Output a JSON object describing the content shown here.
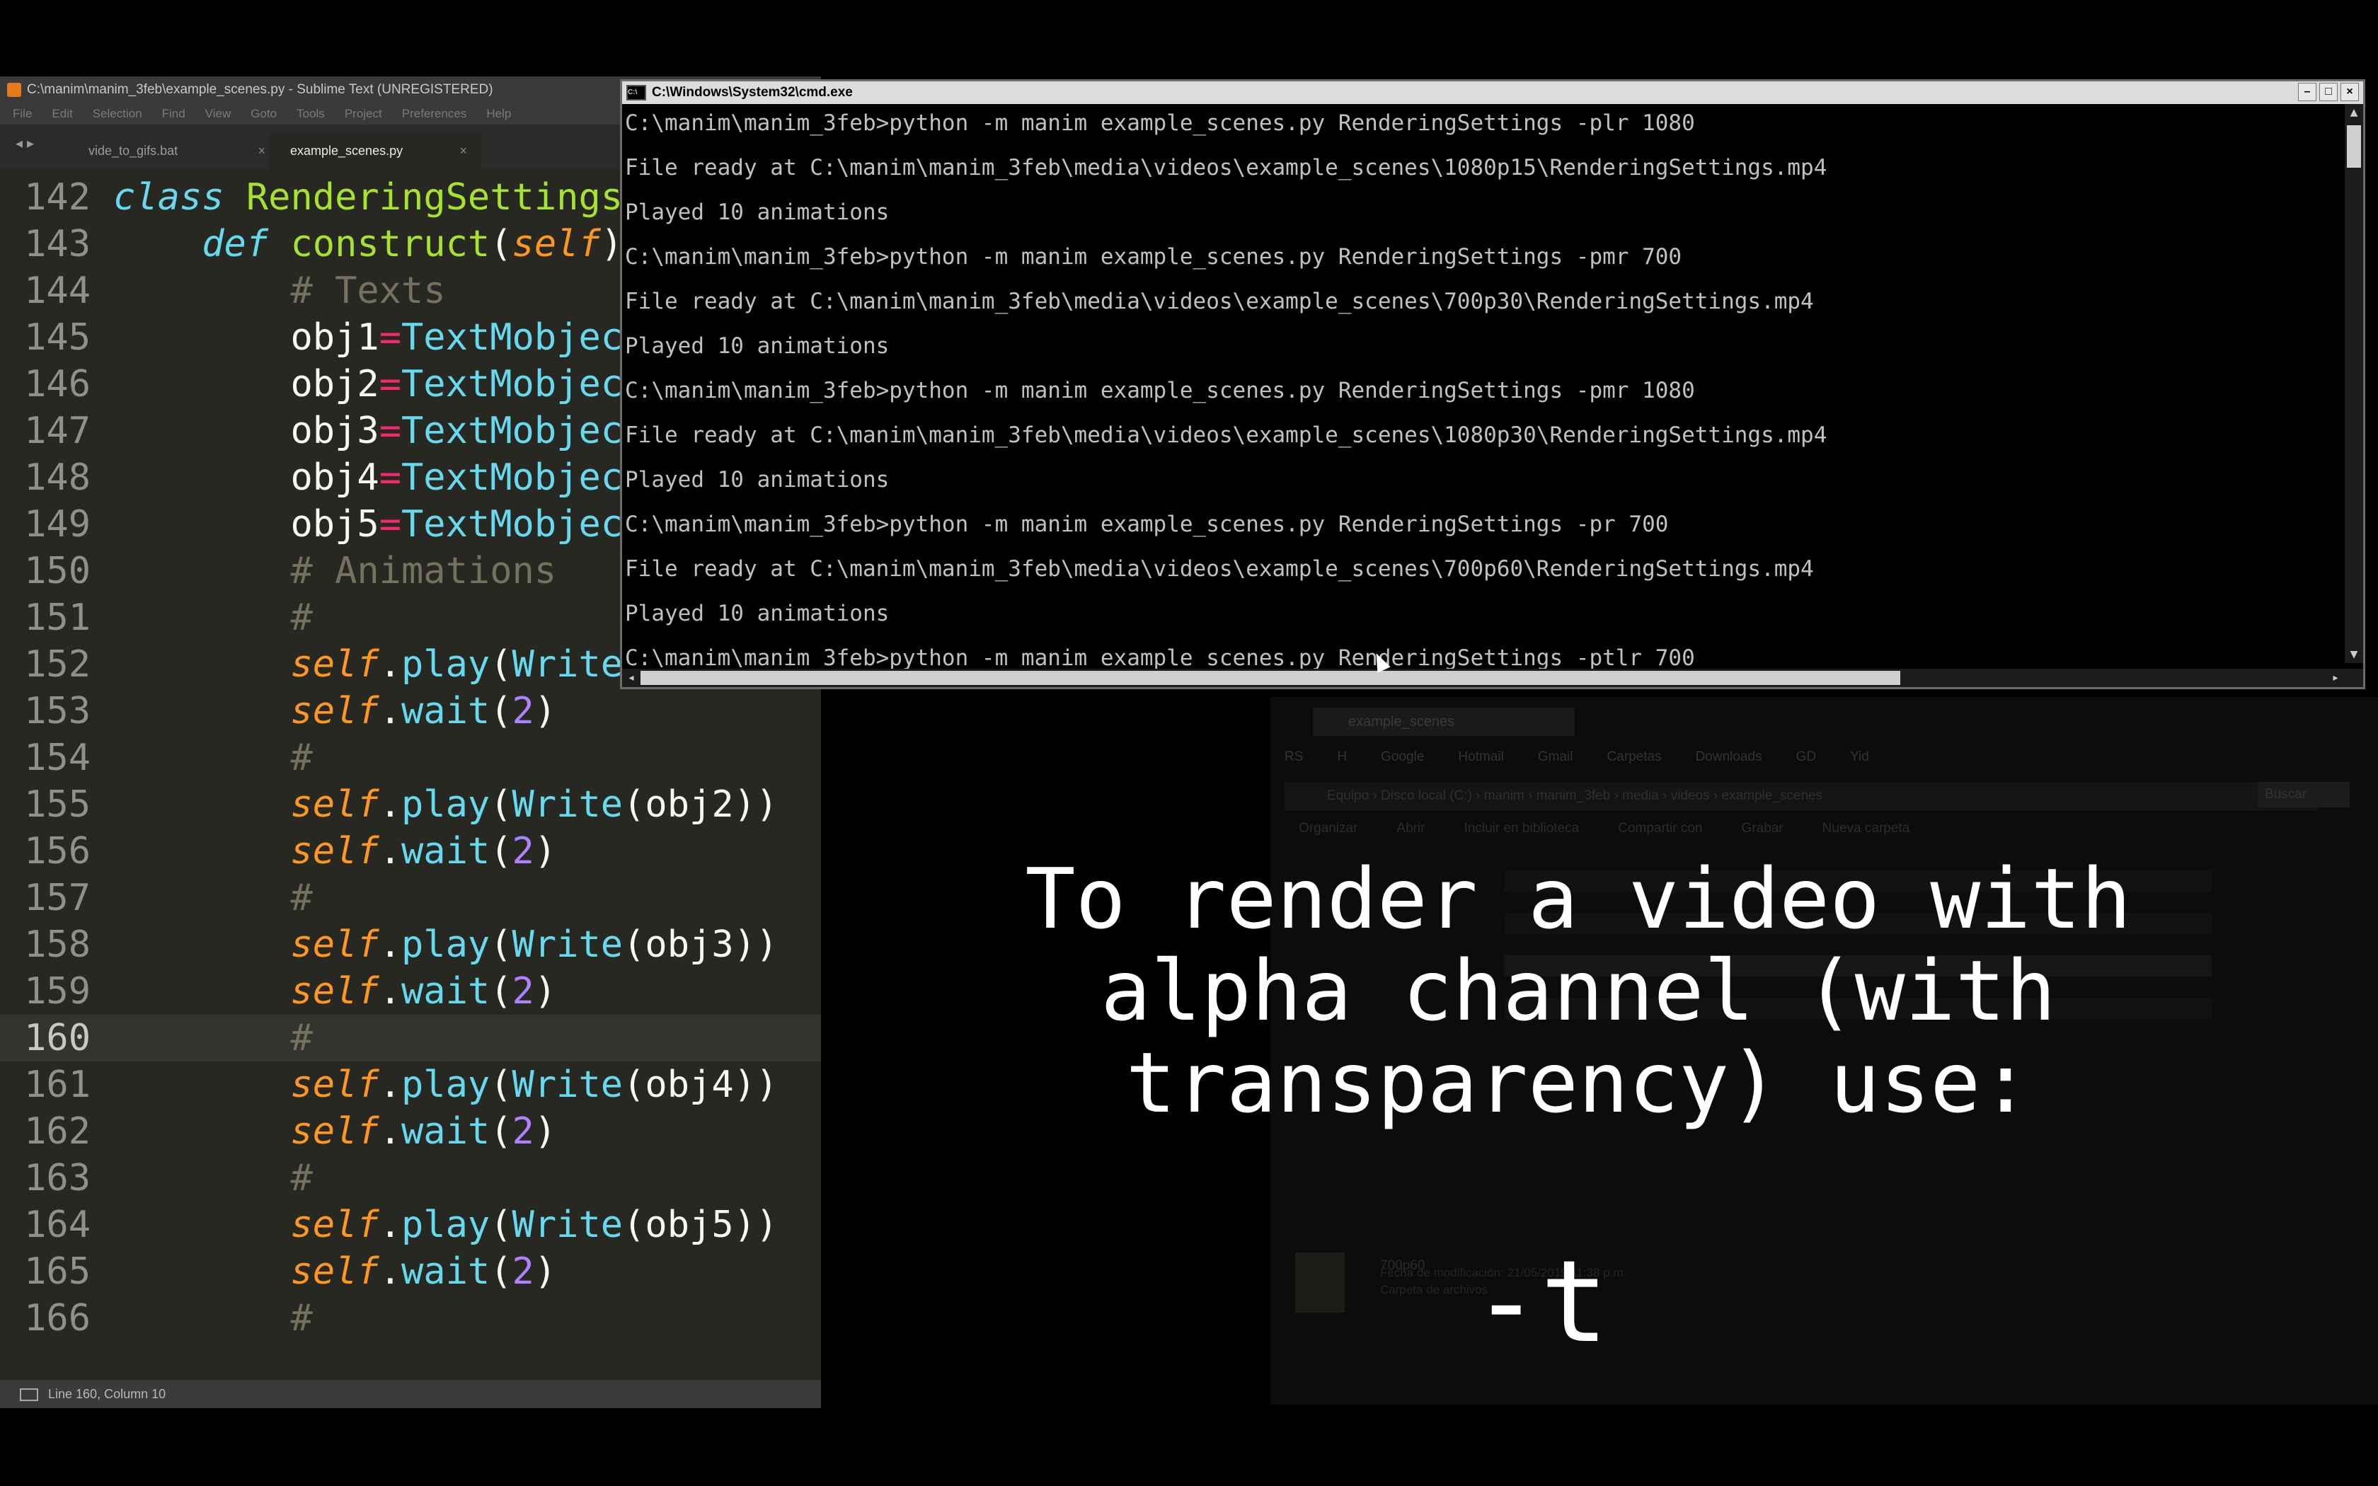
{
  "explorer": {
    "tab_label": "example_scenes",
    "bookmarks": [
      "RS",
      "H",
      "Google",
      "Hotmail",
      "Gmail",
      "Carpetas",
      "Downloads",
      "GD",
      "Yid"
    ],
    "address": "Equipo › Disco local (C:) › manim › manim_3feb › media › videos › example_scenes",
    "search_label": "Buscar",
    "toolbar": [
      "Organizar",
      "Abrir",
      "Incluir en biblioteca",
      "Compartir con",
      "Grabar",
      "Nueva carpeta"
    ],
    "selected_file": {
      "name": "700p60",
      "meta1": "Fecha de modificación: 21/05/2019 11:38 p.m.",
      "meta2": "Carpeta de archivos"
    }
  },
  "sublime": {
    "title": "C:\\manim\\manim_3feb\\example_scenes.py - Sublime Text (UNREGISTERED)",
    "menu": [
      "File",
      "Edit",
      "Selection",
      "Find",
      "View",
      "Goto",
      "Tools",
      "Project",
      "Preferences",
      "Help"
    ],
    "tabs": [
      {
        "label": "vide_to_gifs.bat",
        "active": false
      },
      {
        "label": "example_scenes.py",
        "active": true
      }
    ],
    "status": "Line 160, Column 10",
    "code_lines": [
      {
        "n": "142",
        "tokens": [
          {
            "t": "class",
            "c": "kw"
          },
          {
            "t": " ",
            "c": ""
          },
          {
            "t": "RenderingSettings",
            "c": "cls"
          }
        ]
      },
      {
        "n": "143",
        "tokens": [
          {
            "t": "    ",
            "c": ""
          },
          {
            "t": "def",
            "c": "kw"
          },
          {
            "t": " ",
            "c": ""
          },
          {
            "t": "construct",
            "c": "def"
          },
          {
            "t": "(",
            "c": ""
          },
          {
            "t": "self",
            "c": "self"
          },
          {
            "t": ")",
            "c": ""
          }
        ]
      },
      {
        "n": "144",
        "tokens": [
          {
            "t": "        ",
            "c": ""
          },
          {
            "t": "# Texts",
            "c": "cm"
          }
        ]
      },
      {
        "n": "145",
        "tokens": [
          {
            "t": "        obj1",
            "c": ""
          },
          {
            "t": "=",
            "c": "op"
          },
          {
            "t": "TextMobjec",
            "c": "fn"
          }
        ]
      },
      {
        "n": "146",
        "tokens": [
          {
            "t": "        obj2",
            "c": ""
          },
          {
            "t": "=",
            "c": "op"
          },
          {
            "t": "TextMobjec",
            "c": "fn"
          }
        ]
      },
      {
        "n": "147",
        "tokens": [
          {
            "t": "        obj3",
            "c": ""
          },
          {
            "t": "=",
            "c": "op"
          },
          {
            "t": "TextMobjec",
            "c": "fn"
          }
        ]
      },
      {
        "n": "148",
        "tokens": [
          {
            "t": "        obj4",
            "c": ""
          },
          {
            "t": "=",
            "c": "op"
          },
          {
            "t": "TextMobjec",
            "c": "fn"
          }
        ]
      },
      {
        "n": "149",
        "tokens": [
          {
            "t": "        obj5",
            "c": ""
          },
          {
            "t": "=",
            "c": "op"
          },
          {
            "t": "TextMobjec",
            "c": "fn"
          }
        ]
      },
      {
        "n": "150",
        "tokens": [
          {
            "t": "        ",
            "c": ""
          },
          {
            "t": "# Animations",
            "c": "cm"
          }
        ]
      },
      {
        "n": "151",
        "tokens": [
          {
            "t": "        ",
            "c": ""
          },
          {
            "t": "#",
            "c": "cm"
          }
        ]
      },
      {
        "n": "152",
        "tokens": [
          {
            "t": "        ",
            "c": ""
          },
          {
            "t": "self",
            "c": "self"
          },
          {
            "t": ".",
            "c": ""
          },
          {
            "t": "play",
            "c": "fn"
          },
          {
            "t": "(",
            "c": ""
          },
          {
            "t": "Write",
            "c": "fn"
          }
        ]
      },
      {
        "n": "153",
        "tokens": [
          {
            "t": "        ",
            "c": ""
          },
          {
            "t": "self",
            "c": "self"
          },
          {
            "t": ".",
            "c": ""
          },
          {
            "t": "wait",
            "c": "fn"
          },
          {
            "t": "(",
            "c": ""
          },
          {
            "t": "2",
            "c": "num"
          },
          {
            "t": ")",
            "c": ""
          }
        ]
      },
      {
        "n": "154",
        "tokens": [
          {
            "t": "        ",
            "c": ""
          },
          {
            "t": "#",
            "c": "cm"
          }
        ]
      },
      {
        "n": "155",
        "tokens": [
          {
            "t": "        ",
            "c": ""
          },
          {
            "t": "self",
            "c": "self"
          },
          {
            "t": ".",
            "c": ""
          },
          {
            "t": "play",
            "c": "fn"
          },
          {
            "t": "(",
            "c": ""
          },
          {
            "t": "Write",
            "c": "fn"
          },
          {
            "t": "(obj2))",
            "c": ""
          }
        ]
      },
      {
        "n": "156",
        "tokens": [
          {
            "t": "        ",
            "c": ""
          },
          {
            "t": "self",
            "c": "self"
          },
          {
            "t": ".",
            "c": ""
          },
          {
            "t": "wait",
            "c": "fn"
          },
          {
            "t": "(",
            "c": ""
          },
          {
            "t": "2",
            "c": "num"
          },
          {
            "t": ")",
            "c": ""
          }
        ]
      },
      {
        "n": "157",
        "tokens": [
          {
            "t": "        ",
            "c": ""
          },
          {
            "t": "#",
            "c": "cm"
          }
        ]
      },
      {
        "n": "158",
        "tokens": [
          {
            "t": "        ",
            "c": ""
          },
          {
            "t": "self",
            "c": "self"
          },
          {
            "t": ".",
            "c": ""
          },
          {
            "t": "play",
            "c": "fn"
          },
          {
            "t": "(",
            "c": ""
          },
          {
            "t": "Write",
            "c": "fn"
          },
          {
            "t": "(obj3))",
            "c": ""
          }
        ]
      },
      {
        "n": "159",
        "tokens": [
          {
            "t": "        ",
            "c": ""
          },
          {
            "t": "self",
            "c": "self"
          },
          {
            "t": ".",
            "c": ""
          },
          {
            "t": "wait",
            "c": "fn"
          },
          {
            "t": "(",
            "c": ""
          },
          {
            "t": "2",
            "c": "num"
          },
          {
            "t": ")",
            "c": ""
          }
        ]
      },
      {
        "n": "160",
        "current": true,
        "tokens": [
          {
            "t": "        ",
            "c": ""
          },
          {
            "t": "#",
            "c": "cm"
          }
        ]
      },
      {
        "n": "161",
        "tokens": [
          {
            "t": "        ",
            "c": ""
          },
          {
            "t": "self",
            "c": "self"
          },
          {
            "t": ".",
            "c": ""
          },
          {
            "t": "play",
            "c": "fn"
          },
          {
            "t": "(",
            "c": ""
          },
          {
            "t": "Write",
            "c": "fn"
          },
          {
            "t": "(obj4))",
            "c": ""
          }
        ]
      },
      {
        "n": "162",
        "tokens": [
          {
            "t": "        ",
            "c": ""
          },
          {
            "t": "self",
            "c": "self"
          },
          {
            "t": ".",
            "c": ""
          },
          {
            "t": "wait",
            "c": "fn"
          },
          {
            "t": "(",
            "c": ""
          },
          {
            "t": "2",
            "c": "num"
          },
          {
            "t": ")",
            "c": ""
          }
        ]
      },
      {
        "n": "163",
        "tokens": [
          {
            "t": "        ",
            "c": ""
          },
          {
            "t": "#",
            "c": "cm"
          }
        ]
      },
      {
        "n": "164",
        "tokens": [
          {
            "t": "        ",
            "c": ""
          },
          {
            "t": "self",
            "c": "self"
          },
          {
            "t": ".",
            "c": ""
          },
          {
            "t": "play",
            "c": "fn"
          },
          {
            "t": "(",
            "c": ""
          },
          {
            "t": "Write",
            "c": "fn"
          },
          {
            "t": "(obj5))",
            "c": ""
          }
        ]
      },
      {
        "n": "165",
        "tokens": [
          {
            "t": "        ",
            "c": ""
          },
          {
            "t": "self",
            "c": "self"
          },
          {
            "t": ".",
            "c": ""
          },
          {
            "t": "wait",
            "c": "fn"
          },
          {
            "t": "(",
            "c": ""
          },
          {
            "t": "2",
            "c": "num"
          },
          {
            "t": ")",
            "c": ""
          }
        ]
      },
      {
        "n": "166",
        "tokens": [
          {
            "t": "        ",
            "c": ""
          },
          {
            "t": "#",
            "c": "cm"
          }
        ]
      }
    ]
  },
  "cmd": {
    "title": "C:\\Windows\\System32\\cmd.exe",
    "lines": [
      "C:\\manim\\manim_3feb>python -m manim example_scenes.py RenderingSettings -plr 1080",
      "File ready at C:\\manim\\manim_3feb\\media\\videos\\example_scenes\\1080p15\\RenderingSettings.mp4",
      "Played 10 animations",
      "C:\\manim\\manim_3feb>python -m manim example_scenes.py RenderingSettings -pmr 700",
      "File ready at C:\\manim\\manim_3feb\\media\\videos\\example_scenes\\700p30\\RenderingSettings.mp4",
      "Played 10 animations",
      "C:\\manim\\manim_3feb>python -m manim example_scenes.py RenderingSettings -pmr 1080",
      "File ready at C:\\manim\\manim_3feb\\media\\videos\\example_scenes\\1080p30\\RenderingSettings.mp4",
      "Played 10 animations",
      "C:\\manim\\manim_3feb>python -m manim example_scenes.py RenderingSettings -pr 700",
      "File ready at C:\\manim\\manim_3feb\\media\\videos\\example_scenes\\700p60\\RenderingSettings.mp4",
      "Played 10 animations",
      "C:\\manim\\manim_3feb>python -m manim example_scenes.py RenderingSettings -ptlr 700"
    ]
  },
  "overlay": {
    "caption_lines": [
      "To render a video with",
      "alpha channel (with",
      "transparency) use:"
    ],
    "flag": "-t"
  },
  "colors": {
    "sublime_bg": "#272822",
    "keyword": "#66d9ef",
    "class_name": "#a6e22e",
    "self": "#fd971f",
    "comment": "#75715e",
    "operator": "#f92672",
    "number": "#ae81ff",
    "console_text": "#c0c0c0",
    "caption_text": "#ffffff"
  }
}
